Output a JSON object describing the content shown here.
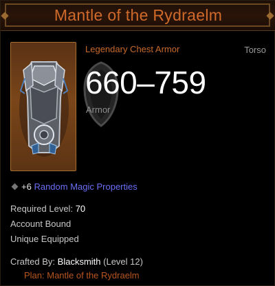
{
  "item": {
    "name": "Mantle of the Rydraelm",
    "type": "Legendary Chest Armor",
    "slot": "Torso",
    "armor_value": "660–759",
    "armor_label": "Armor",
    "icon": "chest-armor-icon"
  },
  "affixes": {
    "random_magic": {
      "count": "+6",
      "label": "Random Magic Properties"
    }
  },
  "requirements": {
    "level_label": "Required Level:",
    "level_value": "70",
    "bound": "Account Bound",
    "unique": "Unique Equipped"
  },
  "crafting": {
    "crafted_by_label": "Crafted By:",
    "crafter": "Blacksmith",
    "crafter_level": "(Level 12)",
    "plan": "Plan: Mantle of the Rydraelm"
  },
  "colors": {
    "legendary": "#cf6a2a",
    "magic": "#6a6ff5",
    "muted": "#8f8f8f",
    "text": "#c8c8c8"
  }
}
